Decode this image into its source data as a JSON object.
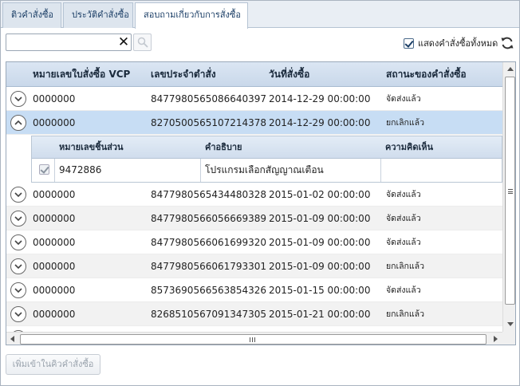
{
  "tabs": [
    {
      "label": "ติวคำสั่งซื้อ"
    },
    {
      "label": "ประวัติคำสั่งซื้อ"
    },
    {
      "label": "สอบถามเกี่ยวกับการสั่งซื้อ"
    }
  ],
  "toolbar": {
    "search_value": "",
    "show_all_label": "แสดงคำสั่งซื้อทั้งหมด",
    "show_all_checked": true
  },
  "grid": {
    "columns": [
      "หมายเลขใบสั่งซื้อ VCP",
      "เลขประจำตำสั่ง",
      "วันที่สั่งซื้อ",
      "สถานะของคำสั่งซื้อ"
    ],
    "rows": [
      {
        "po": "0000000",
        "invoice": "8477980565086640397",
        "date": "2014-12-29 00:00:00",
        "status": "จัดส่งแล้ว"
      },
      {
        "po": "0000000",
        "invoice": "8270500565107214378",
        "date": "2014-12-29 00:00:00",
        "status": "ยกเลิกแล้ว"
      },
      {
        "po": "0000000",
        "invoice": "8477980565434480328",
        "date": "2015-01-02 00:00:00",
        "status": "จัดส่งแล้ว"
      },
      {
        "po": "0000000",
        "invoice": "8477980566056669389",
        "date": "2015-01-09 00:00:00",
        "status": "จัดส่งแล้ว"
      },
      {
        "po": "0000000",
        "invoice": "8477980566061699320",
        "date": "2015-01-09 00:00:00",
        "status": "จัดส่งแล้ว"
      },
      {
        "po": "0000000",
        "invoice": "8477980566061793301",
        "date": "2015-01-09 00:00:00",
        "status": "ยกเลิกแล้ว"
      },
      {
        "po": "0000000",
        "invoice": "8573690566563854326",
        "date": "2015-01-15 00:00:00",
        "status": "จัดส่งแล้ว"
      },
      {
        "po": "0000000",
        "invoice": "8268510567091347305",
        "date": "2015-01-21 00:00:00",
        "status": "ยกเลิกแล้ว"
      }
    ],
    "expanded_detail": {
      "columns": [
        "หมายเลขชิ้นส่วน",
        "คำอธิบาย",
        "ความคิดเห็น"
      ],
      "rows": [
        {
          "part": "9472886",
          "description": "โปรแกรมเลือกสัญญาณเตือน",
          "comment": ""
        }
      ]
    }
  },
  "footer": {
    "add_button_label": "เพิ่มเข้าในคิวคำสั่งซื้อ"
  },
  "colors": {
    "selected_row": "#c7ddf4",
    "header_bg": "#c9d8ea"
  }
}
